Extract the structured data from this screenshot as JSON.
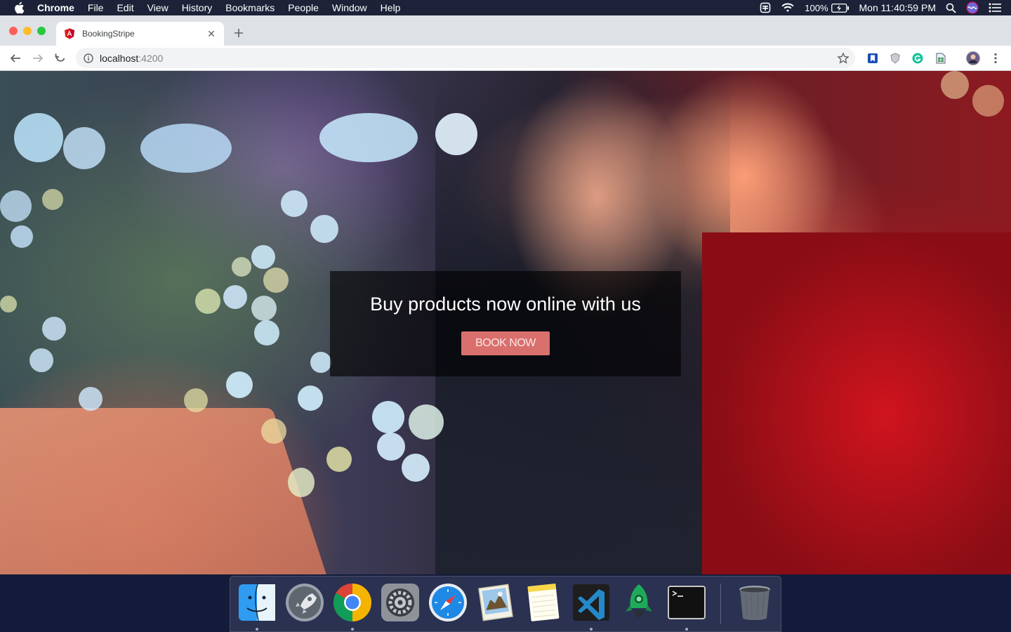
{
  "menubar": {
    "app_name": "Chrome",
    "items": [
      "File",
      "Edit",
      "View",
      "History",
      "Bookmarks",
      "People",
      "Window",
      "Help"
    ],
    "battery": "100%",
    "clock": "Mon 11:40:59 PM"
  },
  "browser": {
    "tab_title": "BookingStripe",
    "url_host": "localhost",
    "url_port": ":4200"
  },
  "hero": {
    "title": "Buy products now online with us",
    "button_label": "BOOK NOW"
  },
  "dock": {
    "apps": [
      "finder-icon",
      "launchpad-icon",
      "chrome-icon",
      "system-preferences-icon",
      "safari-icon",
      "mail-icon",
      "notes-icon",
      "vscode-icon",
      "git-client-icon",
      "terminal-icon",
      "trash-icon"
    ]
  },
  "colors": {
    "button": "#d9706d",
    "card_overlay": "rgba(0,0,0,0.62)",
    "menubar": "#1d2238"
  }
}
